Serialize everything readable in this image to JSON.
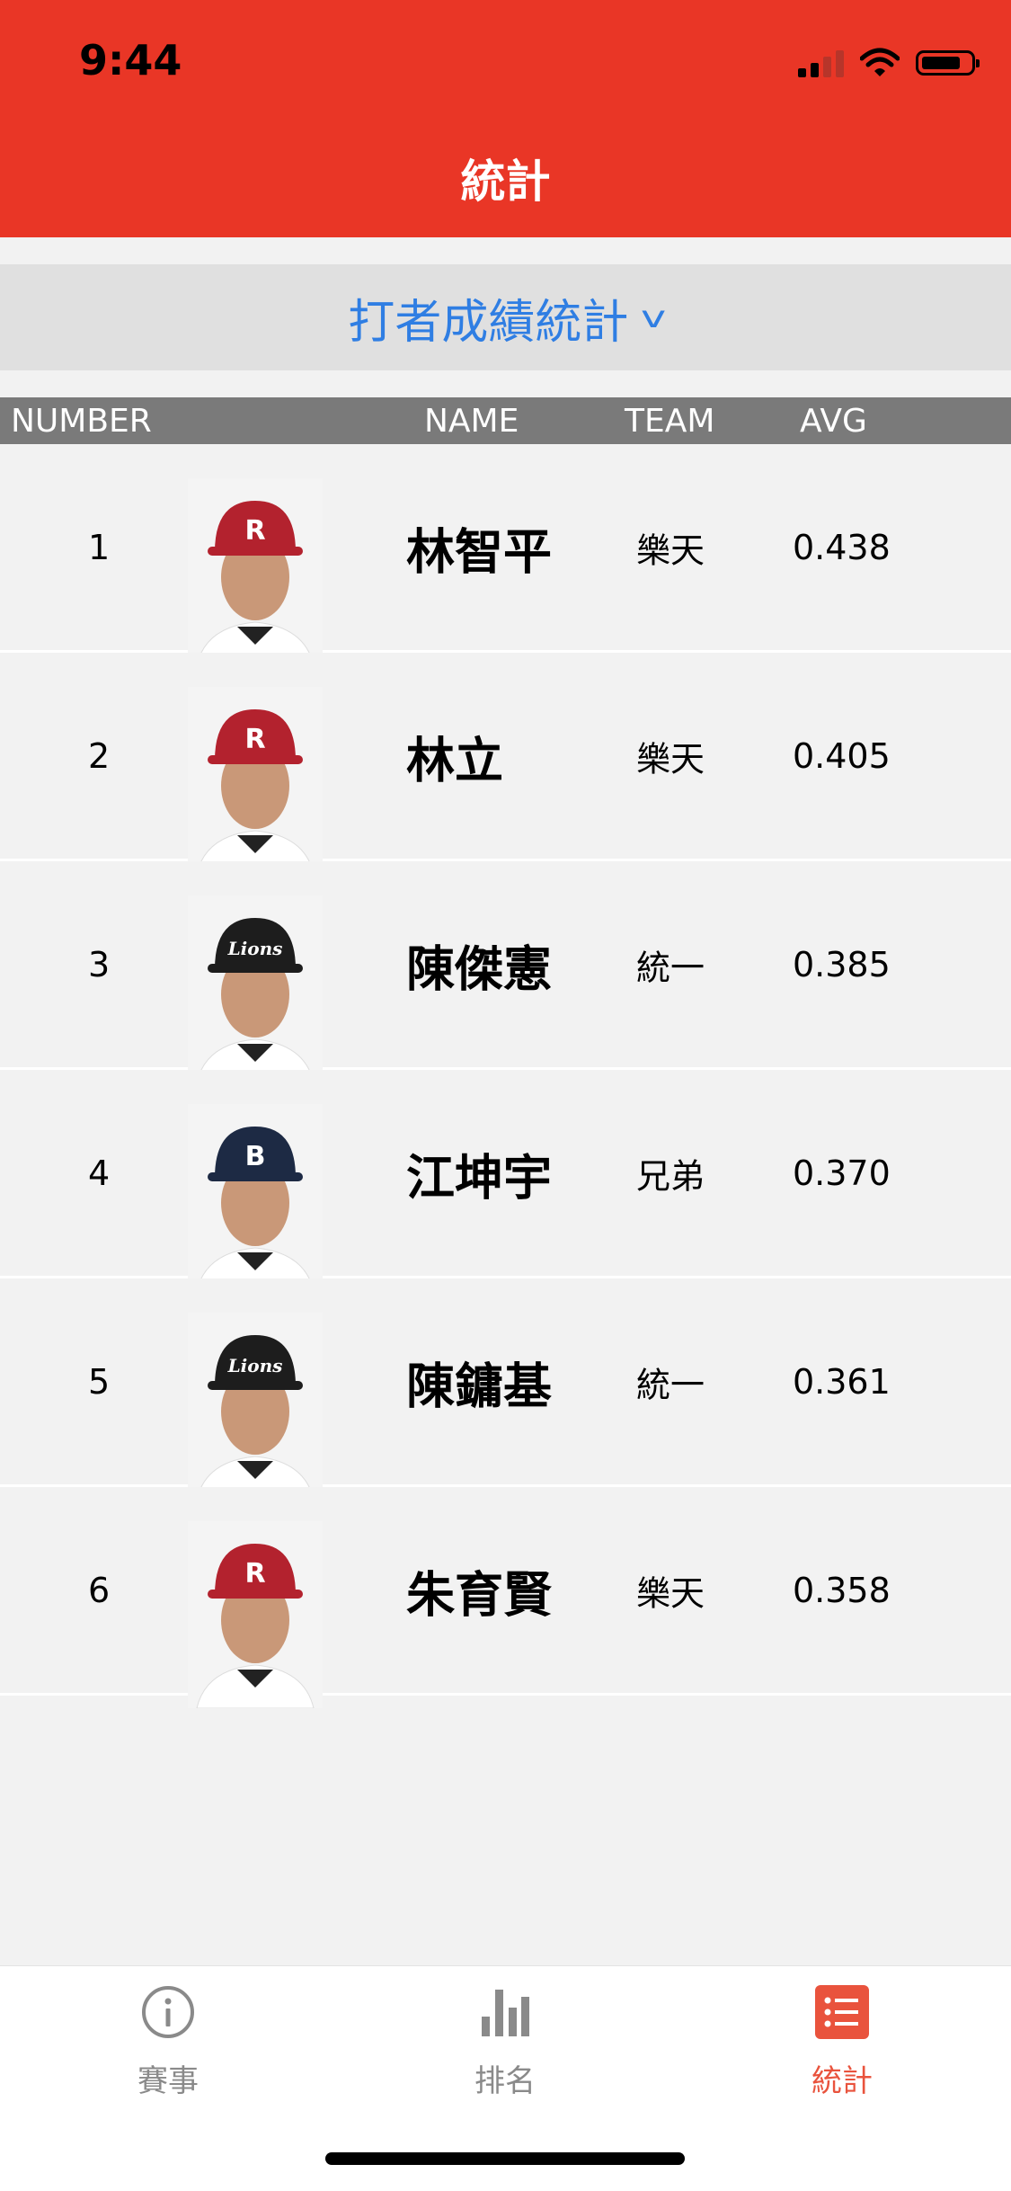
{
  "status_bar": {
    "time": "9:44"
  },
  "nav": {
    "title": "統計"
  },
  "selector": {
    "label": "打者成績統計",
    "chevron": "v"
  },
  "table": {
    "headers": {
      "number": "NUMBER",
      "name": "NAME",
      "team": "TEAM",
      "avg": "AVG"
    },
    "rows": [
      {
        "number": "1",
        "name": "林智平",
        "team": "樂天",
        "avg": "0.438",
        "cap": "R",
        "cap_color": "#b3222e"
      },
      {
        "number": "2",
        "name": "林立",
        "team": "樂天",
        "avg": "0.405",
        "cap": "R",
        "cap_color": "#b3222e"
      },
      {
        "number": "3",
        "name": "陳傑憲",
        "team": "統一",
        "avg": "0.385",
        "cap": "Lions",
        "cap_color": "#1d1d1d"
      },
      {
        "number": "4",
        "name": "江坤宇",
        "team": "兄弟",
        "avg": "0.370",
        "cap": "B",
        "cap_color": "#1d2a44"
      },
      {
        "number": "5",
        "name": "陳鏞基",
        "team": "統一",
        "avg": "0.361",
        "cap": "Lions",
        "cap_color": "#1d1d1d"
      },
      {
        "number": "6",
        "name": "朱育賢",
        "team": "樂天",
        "avg": "0.358",
        "cap": "R",
        "cap_color": "#b3222e"
      }
    ]
  },
  "tabbar": {
    "items": [
      {
        "label": "賽事",
        "icon": "info-icon",
        "active": false
      },
      {
        "label": "排名",
        "icon": "bar-chart-icon",
        "active": false
      },
      {
        "label": "統計",
        "icon": "list-icon",
        "active": true
      }
    ]
  },
  "colors": {
    "header": "#e93626",
    "accent_blue": "#2f7ee3",
    "active_tab": "#e9533d",
    "inactive_tab": "#8a8a8a"
  }
}
